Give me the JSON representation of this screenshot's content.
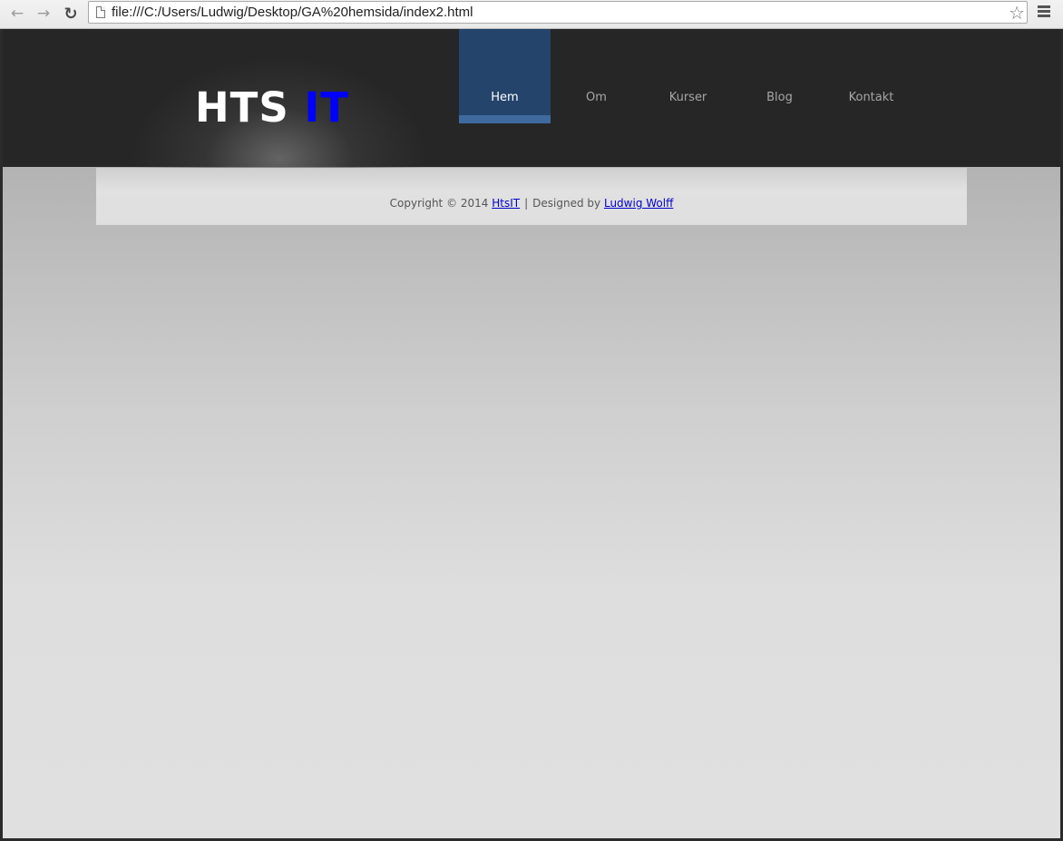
{
  "browser": {
    "url": "file:///C:/Users/Ludwig/Desktop/GA%20hemsida/index2.html",
    "back_icon": "arrow-left-icon",
    "forward_icon": "arrow-right-icon",
    "reload_icon": "reload-icon",
    "bookmark_icon": "star-icon",
    "menu_icon": "hamburger-menu-icon"
  },
  "site": {
    "logo_part1": "HTS",
    "logo_part2": "IT",
    "nav": [
      {
        "label": "Hem",
        "active": true
      },
      {
        "label": "Om",
        "active": false
      },
      {
        "label": "Kurser",
        "active": false
      },
      {
        "label": "Blog",
        "active": false
      },
      {
        "label": "Kontakt",
        "active": false
      }
    ],
    "footer": {
      "copyright": "Copyright © 2014",
      "company_link": "HtsIT",
      "separator": "|",
      "designed_by": "Designed by",
      "designer_link": "Ludwig Wolff"
    },
    "colors": {
      "header_bg": "#262626",
      "active_nav": "#24446b",
      "logo_accent": "#0000ff",
      "link": "#0000cc"
    }
  }
}
